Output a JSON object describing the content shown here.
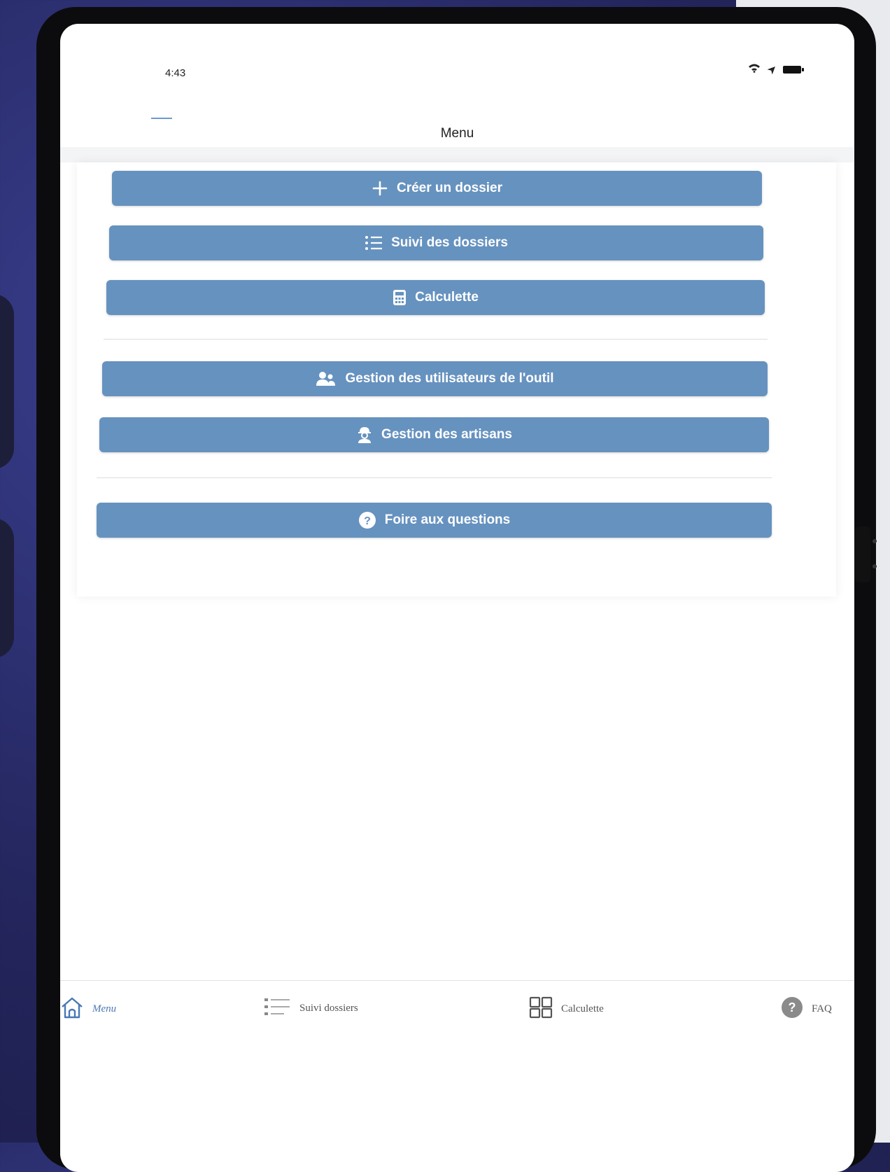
{
  "status_bar": {
    "time": "4:43",
    "wifi_icon": "wifi-icon",
    "location_icon": "location-arrow-icon",
    "battery_icon": "battery-icon"
  },
  "header": {
    "title": "Menu",
    "menu_icon": "hamburger-icon"
  },
  "menu": {
    "items": [
      {
        "label": "Créer un dossier",
        "icon": "plus-icon"
      },
      {
        "label": "Suivi des dossiers",
        "icon": "list-icon"
      },
      {
        "label": "Calculette",
        "icon": "calculator-icon"
      },
      {
        "label": "Gestion des utilisateurs de l'outil",
        "icon": "users-icon"
      },
      {
        "label": "Gestion des artisans",
        "icon": "worker-icon"
      },
      {
        "label": "Foire aux questions",
        "icon": "question-circle-icon"
      }
    ]
  },
  "bottom_nav": {
    "items": [
      {
        "label": "Menu",
        "icon": "home-icon",
        "active": true
      },
      {
        "label": "Suivi dossiers",
        "icon": "list-icon",
        "active": false
      },
      {
        "label": "Calculette",
        "icon": "calculator-icon",
        "active": false
      },
      {
        "label": "FAQ",
        "icon": "question-circle-icon",
        "active": false
      }
    ]
  },
  "colors": {
    "button": "#6692bf",
    "accent": "#4a78b5",
    "page_background": "#ffffff"
  }
}
